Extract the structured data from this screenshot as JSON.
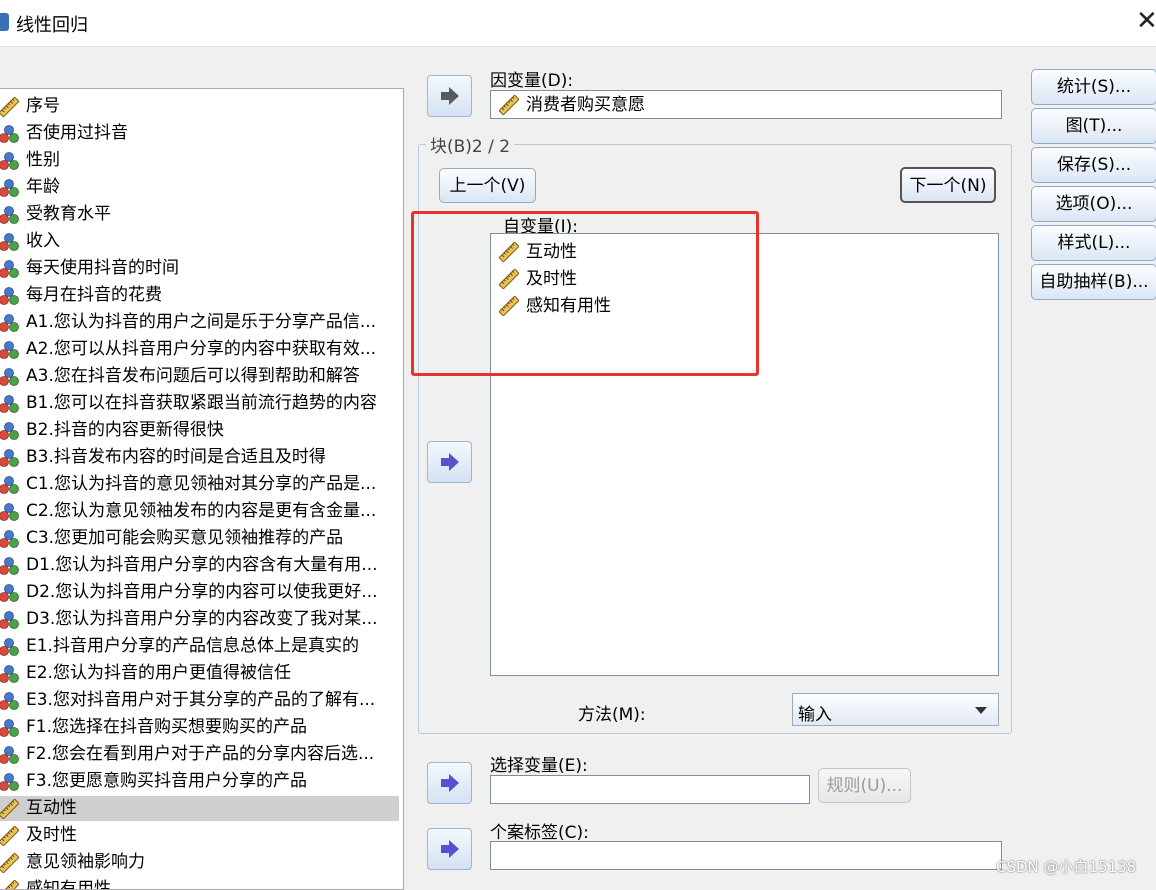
{
  "window": {
    "title": "线性回归",
    "close_glyph": "✕"
  },
  "variables": [
    {
      "label": "序号",
      "icon": "ruler-icon"
    },
    {
      "label": "否使用过抖音",
      "icon": "nominal-icon"
    },
    {
      "label": "性别",
      "icon": "nominal-icon"
    },
    {
      "label": "年龄",
      "icon": "nominal-icon"
    },
    {
      "label": "受教育水平",
      "icon": "nominal-icon"
    },
    {
      "label": "收入",
      "icon": "nominal-icon"
    },
    {
      "label": "每天使用抖音的时间",
      "icon": "nominal-icon"
    },
    {
      "label": "每月在抖音的花费",
      "icon": "nominal-icon"
    },
    {
      "label": "A1.您认为抖音的用户之间是乐于分享产品信...",
      "icon": "nominal-icon"
    },
    {
      "label": "A2.您可以从抖音用户分享的内容中获取有效...",
      "icon": "nominal-icon"
    },
    {
      "label": "A3.您在抖音发布问题后可以得到帮助和解答",
      "icon": "nominal-icon"
    },
    {
      "label": "B1.您可以在抖音获取紧跟当前流行趋势的内容",
      "icon": "nominal-icon"
    },
    {
      "label": "B2.抖音的内容更新得很快",
      "icon": "nominal-icon"
    },
    {
      "label": "B3.抖音发布内容的时间是合适且及时得",
      "icon": "nominal-icon"
    },
    {
      "label": "C1.您认为抖音的意见领袖对其分享的产品是...",
      "icon": "nominal-icon"
    },
    {
      "label": "C2.您认为意见领袖发布的内容是更有含金量...",
      "icon": "nominal-icon"
    },
    {
      "label": "C3.您更加可能会购买意见领袖推荐的产品",
      "icon": "nominal-icon"
    },
    {
      "label": "D1.您认为抖音用户分享的内容含有大量有用...",
      "icon": "nominal-icon"
    },
    {
      "label": "D2.您认为抖音用户分享的内容可以使我更好...",
      "icon": "nominal-icon"
    },
    {
      "label": "D3.您认为抖音用户分享的内容改变了我对某...",
      "icon": "nominal-icon"
    },
    {
      "label": "E1.抖音用户分享的产品信息总体上是真实的",
      "icon": "nominal-icon"
    },
    {
      "label": "E2.您认为抖音的用户更值得被信任",
      "icon": "nominal-icon"
    },
    {
      "label": "E3.您对抖音用户对于其分享的产品的了解有...",
      "icon": "nominal-icon"
    },
    {
      "label": "F1.您选择在抖音购买想要购买的产品",
      "icon": "nominal-icon"
    },
    {
      "label": "F2.您会在看到用户对于产品的分享内容后选...",
      "icon": "nominal-icon"
    },
    {
      "label": "F3.您更愿意购买抖音用户分享的产品",
      "icon": "nominal-icon"
    },
    {
      "label": "互动性",
      "icon": "ruler-icon",
      "selected": true
    },
    {
      "label": "及时性",
      "icon": "ruler-icon"
    },
    {
      "label": "意见领袖影响力",
      "icon": "ruler-icon"
    },
    {
      "label": "感知有用性",
      "icon": "ruler-icon"
    }
  ],
  "dependent": {
    "label": "因变量(D):",
    "value": "消费者购买意愿",
    "icon": "ruler-icon"
  },
  "block": {
    "legend": "块(B)2 / 2",
    "prev_label": "上一个(V)",
    "next_label": "下一个(N)"
  },
  "independent": {
    "label": "自变量(I):",
    "items": [
      {
        "label": "互动性",
        "icon": "ruler-icon"
      },
      {
        "label": "及时性",
        "icon": "ruler-icon"
      },
      {
        "label": "感知有用性",
        "icon": "ruler-icon"
      }
    ]
  },
  "method": {
    "label": "方法(M):",
    "value": "输入"
  },
  "selection": {
    "label": "选择变量(E):",
    "value": "",
    "rule_label": "规则(U)..."
  },
  "case_label": {
    "label": "个案标签(C):",
    "value": ""
  },
  "side_buttons": [
    "统计(S)...",
    "图(T)...",
    "保存(S)...",
    "选项(O)...",
    "样式(L)...",
    "自助抽样(B)..."
  ],
  "watermark": "CSDN @小白15138",
  "colors": {
    "highlight": "#e8322b",
    "selected_row": "#cfcfcf",
    "arrow": "#5a4fcf"
  }
}
